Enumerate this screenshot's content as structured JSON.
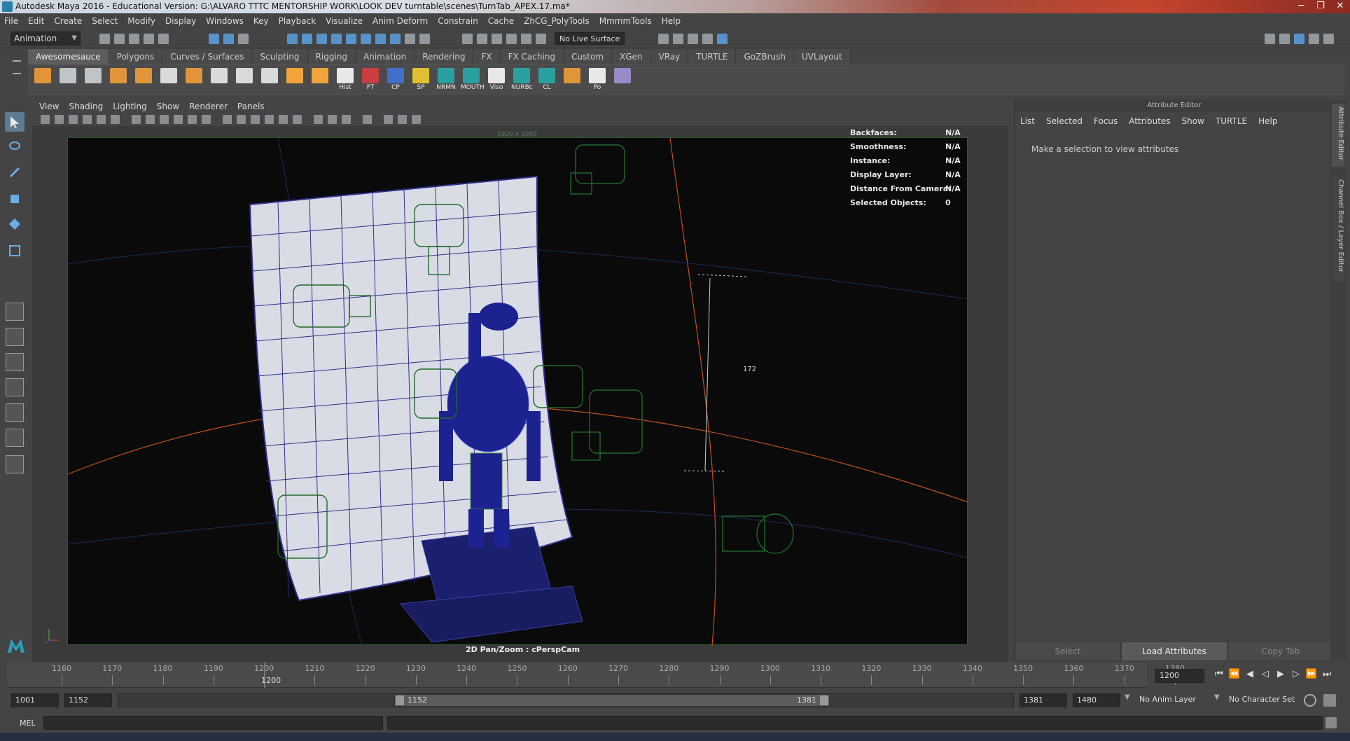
{
  "window": {
    "title": "Autodesk Maya 2016 - Educational Version: G:\\ALVARO TTTC MENTORSHIP WORK\\LOOK DEV turntable\\scenes\\TurnTab_APEX.17.ma*",
    "min": "─",
    "max": "❐",
    "close": "✕"
  },
  "menus": [
    "File",
    "Edit",
    "Create",
    "Select",
    "Modify",
    "Display",
    "Windows",
    "Key",
    "Playback",
    "Visualize",
    "Anim Deform",
    "Constrain",
    "Cache",
    "ZhCG_PolyTools",
    "MmmmTools",
    "Help"
  ],
  "status": {
    "mode": "Animation",
    "live_surface": "No Live Surface"
  },
  "shelf": {
    "tabs": [
      "Awesomesauce",
      "Polygons",
      "Curves / Surfaces",
      "Sculpting",
      "Rigging",
      "Animation",
      "Rendering",
      "FX",
      "FX Caching",
      "Custom",
      "XGen",
      "VRay",
      "TURTLE",
      "GoZBrush",
      "UVLayout"
    ],
    "active_tab": "Awesomesauce",
    "labels": [
      "Hist",
      "FT",
      "CP",
      "SP",
      "NRMN",
      "MOUTH",
      "Viso",
      "NURBc",
      "CL",
      "Po"
    ]
  },
  "panel": {
    "menus": [
      "View",
      "Shading",
      "Lighting",
      "Show",
      "Renderer",
      "Panels"
    ],
    "resolution": "1920 x 1080",
    "camera": "2D Pan/Zoom : cPerspCam",
    "measure": "172"
  },
  "hud": [
    {
      "label": "Backfaces:",
      "value": "N/A"
    },
    {
      "label": "Smoothness:",
      "value": "N/A"
    },
    {
      "label": "Instance:",
      "value": "N/A"
    },
    {
      "label": "Display Layer:",
      "value": "N/A"
    },
    {
      "label": "Distance From Camera:",
      "value": "N/A"
    },
    {
      "label": "Selected Objects:",
      "value": "0"
    }
  ],
  "attribute_editor": {
    "title": "Attribute Editor",
    "menus": [
      "List",
      "Selected",
      "Focus",
      "Attributes",
      "Show",
      "TURTLE",
      "Help"
    ],
    "message": "Make a selection to view attributes",
    "buttons": [
      "Select",
      "Load Attributes",
      "Copy Tab"
    ],
    "side_tabs": [
      "Attribute Editor",
      "Channel Box / Layer Editor"
    ]
  },
  "timeline": {
    "ticks": [
      1160,
      1170,
      1180,
      1190,
      1200,
      1210,
      1220,
      1230,
      1240,
      1250,
      1260,
      1270,
      1280,
      1290,
      1300,
      1310,
      1320,
      1330,
      1340,
      1350,
      1360,
      1370,
      1380
    ],
    "current_frame": "1200",
    "current_field": "1200"
  },
  "range": {
    "start": "1001",
    "inner_start": "1152",
    "slider_start": "1152",
    "slider_end": "1381",
    "inner_end": "1381",
    "end": "1480",
    "anim_layer": "No Anim Layer",
    "character_set": "No Character Set"
  },
  "command": {
    "label": "MEL"
  }
}
